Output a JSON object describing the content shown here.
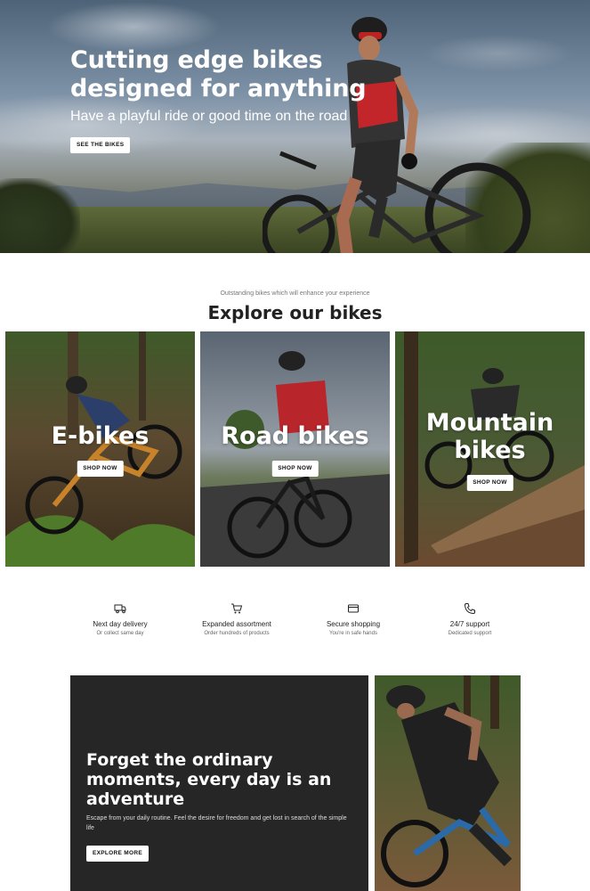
{
  "hero": {
    "title": "Cutting edge bikes designed for anything",
    "subtitle": "Have a playful ride or good time on the road",
    "button": "SEE THE BIKES"
  },
  "explore": {
    "kicker": "Outstanding bikes which will enhance your experience",
    "title": "Explore our bikes",
    "cards": [
      {
        "label": "E-bikes",
        "button": "SHOP NOW"
      },
      {
        "label": "Road bikes",
        "button": "SHOP NOW"
      },
      {
        "label": "Mountain bikes",
        "button": "SHOP NOW"
      }
    ]
  },
  "features": [
    {
      "icon": "truck-icon",
      "title": "Next day delivery",
      "subtitle": "Or collect same day"
    },
    {
      "icon": "cart-icon",
      "title": "Expanded assortment",
      "subtitle": "Order hundreds of products"
    },
    {
      "icon": "credit-card-icon",
      "title": "Secure shopping",
      "subtitle": "You're in safe hands"
    },
    {
      "icon": "phone-icon",
      "title": "24/7 support",
      "subtitle": "Dedicated support"
    }
  ],
  "promo": {
    "title": "Forget the ordinary moments, every day is an adventure",
    "text": "Escape from your daily routine. Feel the desire for freedom and get lost in search of the simple life",
    "button": "EXPLORE MORE"
  },
  "colors": {
    "dark_panel": "#262626",
    "text": "#222222",
    "muted": "#777777"
  }
}
